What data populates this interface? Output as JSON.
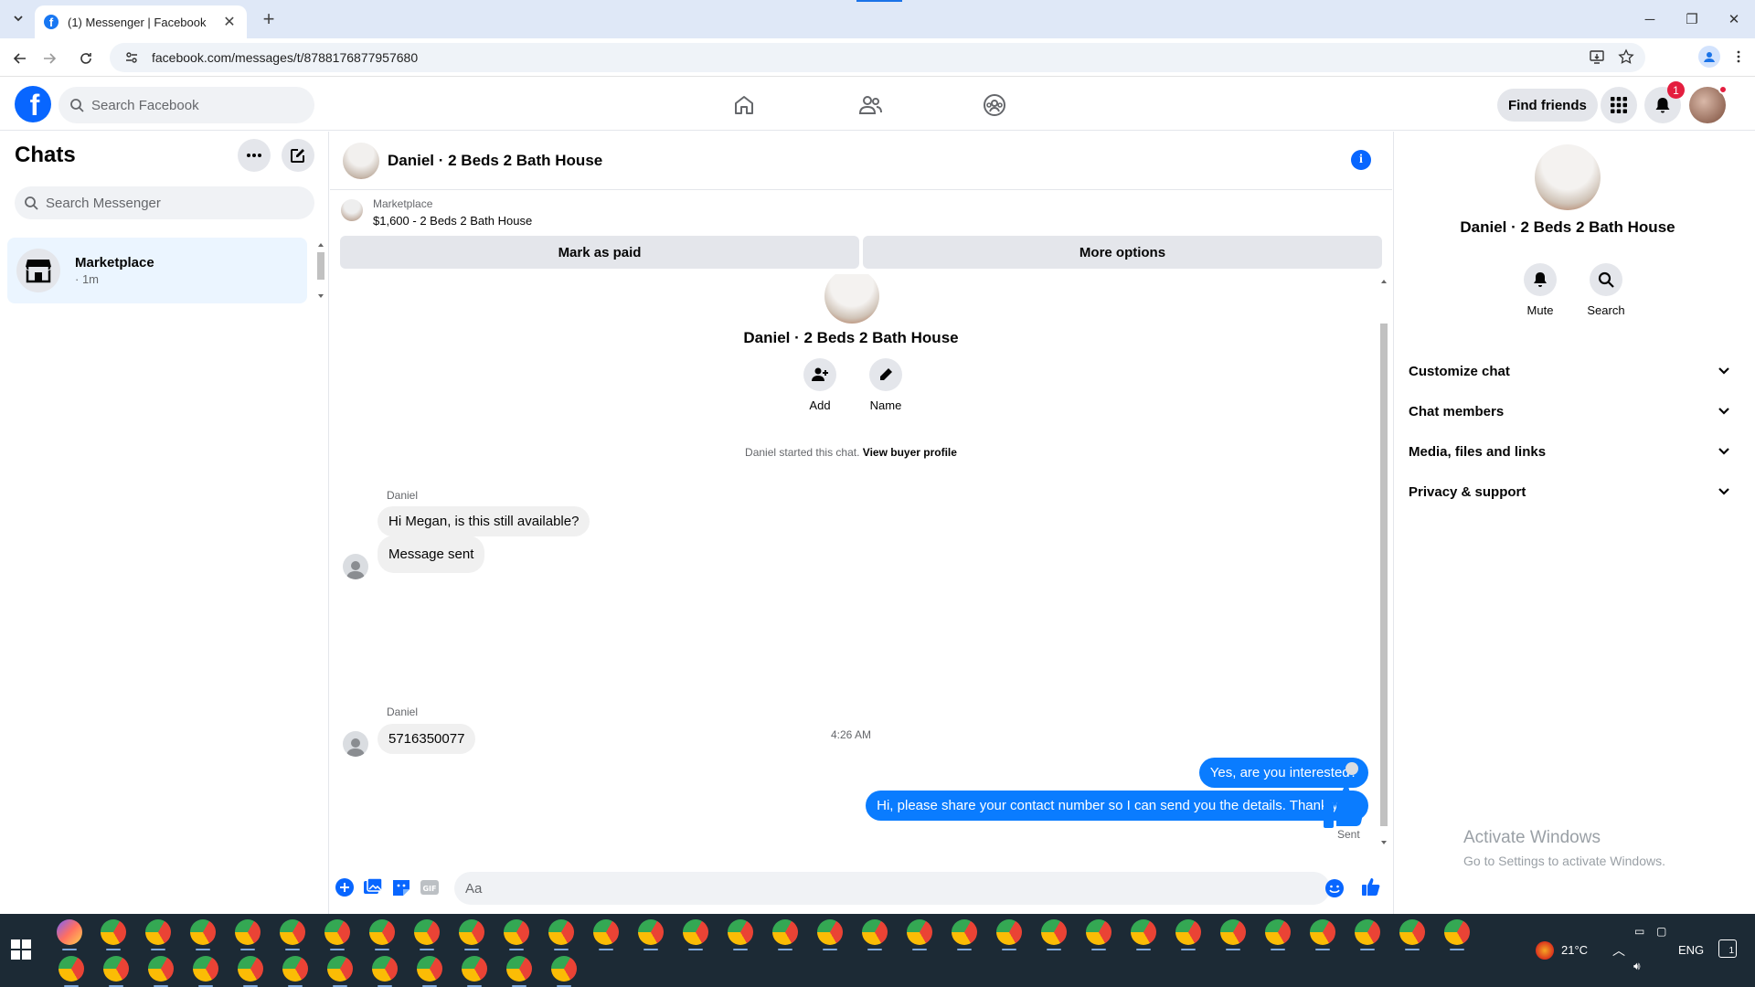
{
  "browser": {
    "tab_title": "(1) Messenger | Facebook",
    "url": "facebook.com/messages/t/8788176877957680"
  },
  "header": {
    "search_placeholder": "Search Facebook",
    "find_friends": "Find friends",
    "notification_count": "1"
  },
  "sidebar": {
    "title": "Chats",
    "search_placeholder": "Search Messenger",
    "chats": [
      {
        "name": "Marketplace",
        "time": "· 1m"
      }
    ]
  },
  "conversation": {
    "title": "Daniel · 2 Beds 2 Bath House",
    "marketplace_label": "Marketplace",
    "listing": "$1,600 - 2 Beds 2 Bath House",
    "mark_paid": "Mark as paid",
    "more_options": "More options",
    "intro_name": "Daniel · 2 Beds 2 Bath House",
    "add_label": "Add",
    "name_label": "Name",
    "system_text": "Daniel started this chat.",
    "system_link": "View buyer profile",
    "sender": "Daniel",
    "messages_in_1": [
      "Hi Megan, is this still available?",
      "Message sent"
    ],
    "timestamp": "4:26 AM",
    "messages_out": [
      "Yes, are you interested?",
      "Hi, please share your contact number so I can send you the details. Thank you!"
    ],
    "messages_in_2": [
      "5716350077"
    ],
    "sent_label": "Sent",
    "composer_placeholder": "Aa"
  },
  "right_panel": {
    "name": "Daniel · 2 Beds 2 Bath House",
    "mute": "Mute",
    "search": "Search",
    "sections": [
      "Customize chat",
      "Chat members",
      "Media, files and links",
      "Privacy & support"
    ]
  },
  "watermark": {
    "line1": "Activate Windows",
    "line2": "Go to Settings to activate Windows."
  },
  "taskbar": {
    "temperature": "21°C",
    "language": "ENG",
    "notification_count": "1"
  },
  "colors": {
    "fb_blue": "#0866ff",
    "bubble_out": "#0a7cff",
    "taskbar": "#1c2a35"
  }
}
